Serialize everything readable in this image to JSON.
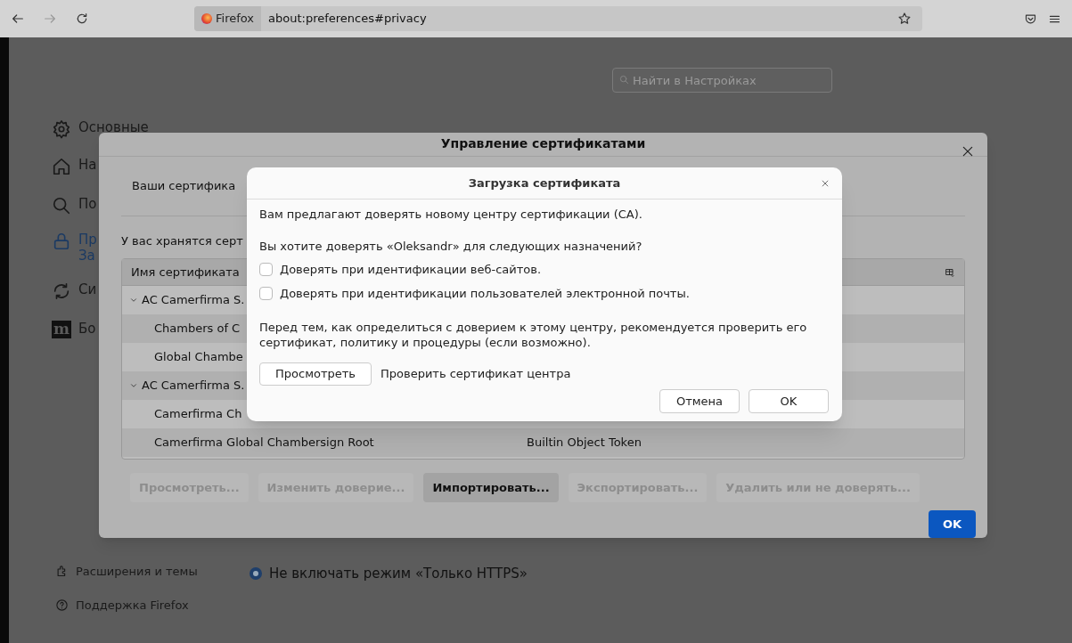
{
  "toolbar": {
    "url_chip": "Firefox",
    "url": "about:preferences#privacy"
  },
  "search": {
    "placeholder": "Найти в Настройках"
  },
  "sidebar": {
    "items": [
      {
        "kind": "gear",
        "lines": [
          "Основные"
        ],
        "selected": false
      },
      {
        "kind": "home",
        "lines": [
          "На"
        ],
        "selected": false
      },
      {
        "kind": "search",
        "lines": [
          "По"
        ],
        "selected": false
      },
      {
        "kind": "lock",
        "lines": [
          "Пр",
          "За"
        ],
        "selected": true
      },
      {
        "kind": "sync",
        "lines": [
          "Си"
        ],
        "selected": false
      },
      {
        "kind": "m",
        "icon_text": "m",
        "lines": [
          "Бо"
        ],
        "selected": false
      }
    ]
  },
  "cert_manager": {
    "title": "Управление сертификатами",
    "tab": "Ваши сертифика",
    "description": "У вас хранятся серт",
    "table": {
      "columns": [
        "Имя сертификата"
      ],
      "rows": [
        {
          "name": "AC Camerfirma S.",
          "expanded": true,
          "children": [
            {
              "name": "Chambers of C"
            },
            {
              "name": "Global Chambe"
            }
          ]
        },
        {
          "name": "AC Camerfirma S.",
          "expanded": true,
          "children": [
            {
              "name": "Camerfirma Ch"
            },
            {
              "name": "Camerfirma Global Chambersign Root",
              "token": "Builtin Object Token"
            }
          ]
        }
      ]
    },
    "buttons": [
      {
        "label": "Просмотреть...",
        "disabled": true
      },
      {
        "label": "Изменить доверие...",
        "disabled": true
      },
      {
        "label": "Импортировать...",
        "disabled": false
      },
      {
        "label": "Экспортировать...",
        "disabled": true
      },
      {
        "label": "Удалить или не доверять...",
        "disabled": true
      }
    ],
    "ok": "OK"
  },
  "import_dialog": {
    "title": "Загрузка сертификата",
    "intro": "Вам предлагают доверять новому центру сертификации (CA).",
    "question": "Вы хотите доверять «Oleksandr» для следующих назначений?",
    "options": [
      {
        "label": "Доверять при идентификации веб-сайтов.",
        "checked": false
      },
      {
        "label": "Доверять при идентификации пользователей электронной почты.",
        "checked": false
      }
    ],
    "advice": "Перед тем, как определиться с доверием к этому центру, рекомендуется проверить его сертификат, политику и процедуры (если возможно).",
    "view_button": "Просмотреть",
    "view_label": "Проверить сертификат центра",
    "buttons": [
      "Отмена",
      "OK"
    ]
  },
  "https_option": {
    "label": "Не включать режим «Только HTTPS»",
    "selected": true
  },
  "footer_links": [
    {
      "kind": "puzzle",
      "label": "Расширения и темы"
    },
    {
      "kind": "help",
      "label": "Поддержка Firefox"
    }
  ]
}
